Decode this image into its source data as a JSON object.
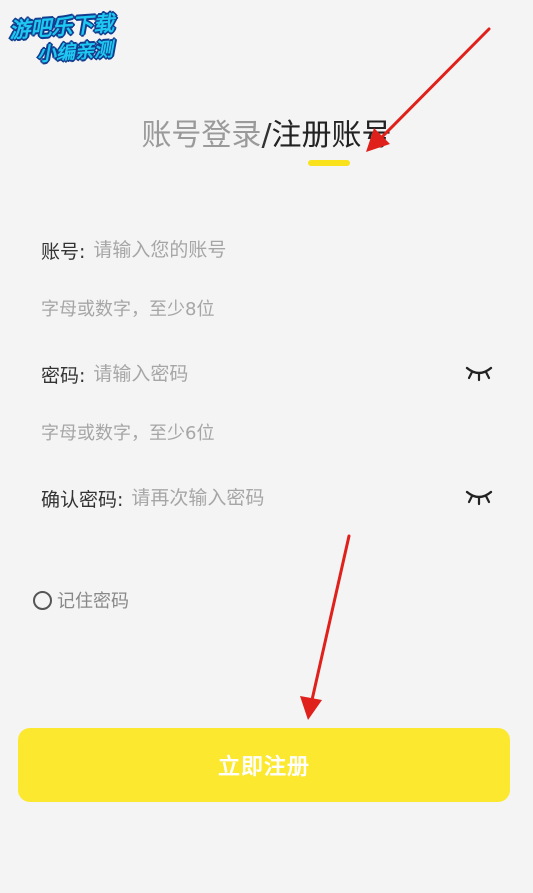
{
  "watermark": {
    "line1": "游吧乐下载",
    "line2": "小编亲测"
  },
  "tabs": {
    "login": "账号登录",
    "separator": "/",
    "register": "注册账号"
  },
  "form": {
    "account": {
      "label": "账号:",
      "placeholder": "请输入您的账号",
      "hint": "字母或数字，至少8位"
    },
    "password": {
      "label": "密码:",
      "placeholder": "请输入密码",
      "hint": "字母或数字，至少6位"
    },
    "confirm": {
      "label": "确认密码:",
      "placeholder": "请再次输入密码"
    }
  },
  "remember": {
    "label": "记住密码",
    "checked": false
  },
  "submit": {
    "label": "立即注册"
  },
  "colors": {
    "accent": "#fbe82f",
    "annotation": "#e0201a",
    "background": "#f4f4f4"
  },
  "icons": {
    "password_toggle": "eye-closed-icon",
    "confirm_toggle": "eye-closed-icon"
  }
}
